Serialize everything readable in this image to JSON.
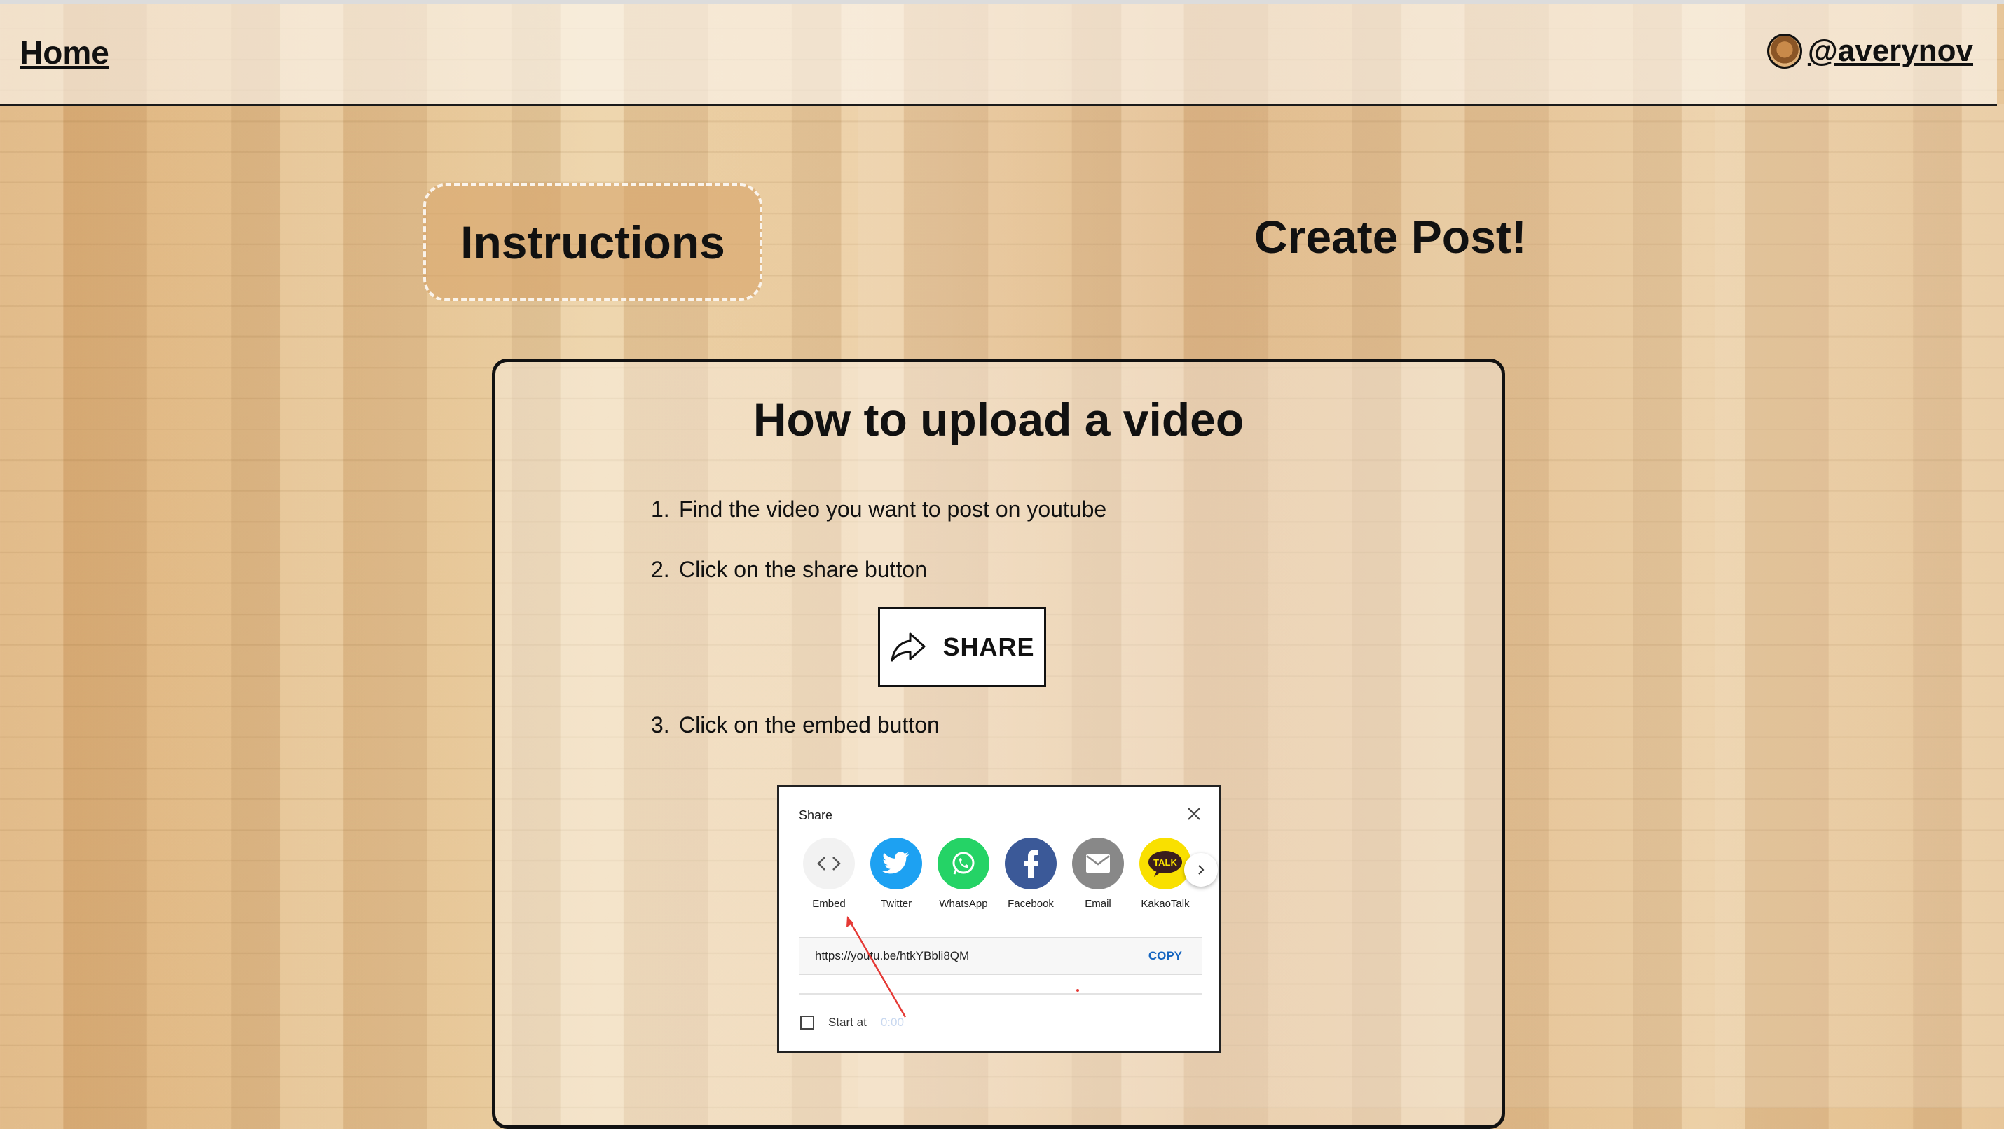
{
  "header": {
    "home_label": "Home",
    "username": "@averynov"
  },
  "tabs": {
    "instructions": "Instructions",
    "create_post": "Create Post!"
  },
  "card": {
    "title": "How to upload a video",
    "steps": [
      {
        "num": "1.",
        "text": "Find the video you want to post on youtube"
      },
      {
        "num": "2.",
        "text": "Click on the share button"
      },
      {
        "num": "3.",
        "text": "Click on the embed button"
      }
    ],
    "share_button_label": "SHARE"
  },
  "share_dialog": {
    "title": "Share",
    "icons": [
      {
        "name": "embed-icon",
        "label": "Embed"
      },
      {
        "name": "twitter-icon",
        "label": "Twitter"
      },
      {
        "name": "whatsapp-icon",
        "label": "WhatsApp"
      },
      {
        "name": "facebook-icon",
        "label": "Facebook"
      },
      {
        "name": "email-icon",
        "label": "Email"
      },
      {
        "name": "kakaotalk-icon",
        "label": "KakaoTalk"
      }
    ],
    "kakao_badge": "TALK",
    "url": "https://youtu.be/htkYBbli8QM",
    "copy_label": "COPY",
    "start_at_label": "Start at",
    "start_time": "0:00"
  },
  "colors": {
    "twitter": "#1da1f2",
    "whatsapp": "#25d366",
    "facebook": "#3b5998",
    "email": "#888888",
    "kakao": "#f9e000",
    "annotation_arrow": "#e53935"
  }
}
